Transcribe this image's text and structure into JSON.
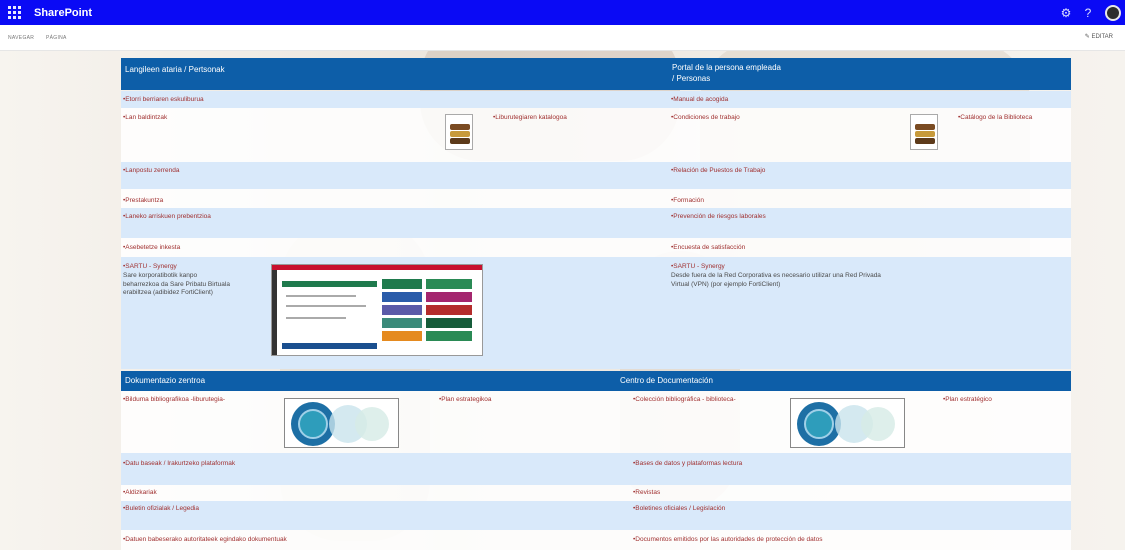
{
  "suite_bar": {
    "app_name": "SharePoint",
    "waffle_icon": "app-launcher-icon",
    "settings_icon": "gear-icon",
    "help_icon": "?",
    "avatar_icon": "user-avatar-icon"
  },
  "command_bar": {
    "crumbs": [
      "NAVEGAR",
      "PÁGINA"
    ],
    "edit_label": "EDITAR"
  },
  "sections": {
    "portal_eu_title": "Langileen ataria / Pertsonak",
    "portal_es_title_1": "Portal de la persona empleada",
    "portal_es_title_2": "/ Personas",
    "doc_eu_title": "Dokumentazio zentroa",
    "doc_es_title": "Centro de Documentación"
  },
  "portal_links": {
    "eu": {
      "welcome": "•Etorri berriaren eskuliburua",
      "work_conditions": "•Lan baldintzak",
      "library_catalog": "•Liburutegiaren katalogoa",
      "job_list": "•Lanpostu zerrenda",
      "training": "•Prestakuntza",
      "risk_prevention": "•Laneko arriskuen prebentzioa",
      "satisfaction": "•Asebetetze inkesta",
      "sartu": "•SARTU - Synergy",
      "sartu_desc_1": "Sare korporatibotik kanpo",
      "sartu_desc_2": "beharrezkoa da Sare Pribatu Birtuala",
      "sartu_desc_3": "erabiltzea (adibidez FortiClient)"
    },
    "es": {
      "welcome": "•Manual de acogida",
      "work_conditions": "•Condiciones de trabajo",
      "library_catalog": "•Catálogo de la Biblioteca",
      "job_list": "•Relación de Puestos de Trabajo",
      "training": "•Formación",
      "risk_prevention": "•Prevención de riesgos laborales",
      "satisfaction": "•Encuesta de satisfacción",
      "sartu": "•SARTU - Synergy",
      "sartu_desc_1": "Desde fuera de la Red Corporativa es necesario utilizar una Red Privada",
      "sartu_desc_2": "Virtual (VPN) (por ejemplo FortiClient)"
    }
  },
  "doc_links": {
    "eu": {
      "bibliography": "•Bilduma bibliografikoa -liburutegia-",
      "strategic_plan": "•Plan estrategikoa",
      "databases": "•Datu baseak / Irakurtzeko plataformak",
      "magazines": "•Aldizkariak",
      "bulletins": "•Buletin ofizialak / Legedia",
      "dpa_docs": "•Datuen babeserako autoritateek egindako dokumentuak"
    },
    "es": {
      "bibliography": "•Colección bibliográfica - biblioteca-",
      "strategic_plan": "•Plan estratégico",
      "databases": "•Bases de datos y plataformas lectura",
      "magazines": "•Revistas",
      "bulletins": "•Boletines oficiales / Legislación",
      "dpa_docs": "•Documentos emitidos por las autoridades de protección de datos"
    }
  },
  "colors": {
    "suite_bar": "#0a0af5",
    "section_header": "#0d5ea8",
    "link": "#a03030",
    "band": "#d9e9fa"
  }
}
